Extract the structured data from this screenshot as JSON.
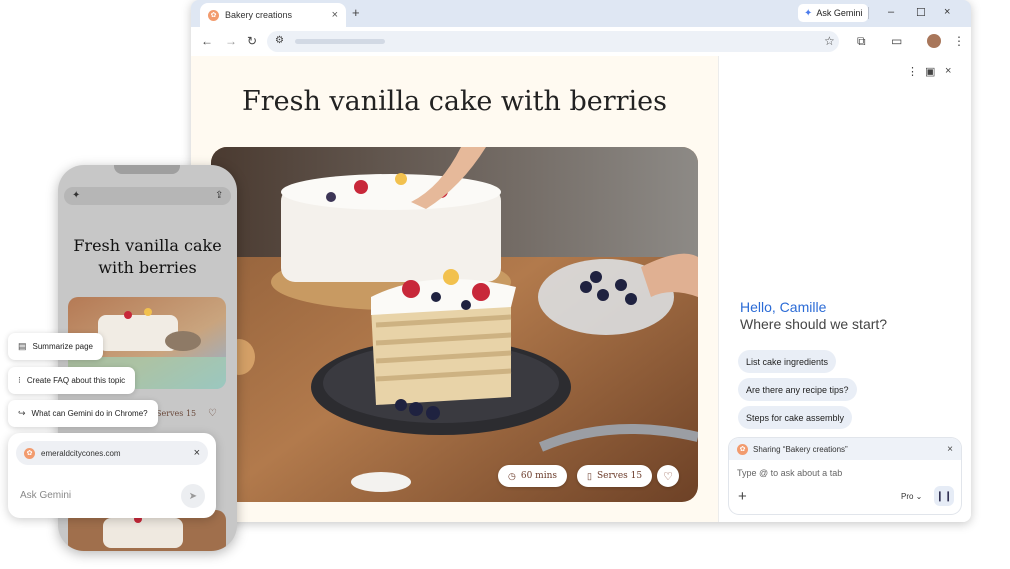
{
  "browser": {
    "tab_title": "Bakery creations",
    "new_tab_glyph": "+",
    "tab_close_glyph": "×",
    "ask_gemini_label": "Ask Gemini",
    "window_controls": {
      "minimize": "–",
      "maximize": "☐",
      "close": "×"
    },
    "toolbar": {
      "back": "←",
      "forward": "→",
      "reload": "↻",
      "tune": "⚙",
      "star": "☆",
      "extensions": "⧉",
      "cast": "▭",
      "menu": "⋮"
    }
  },
  "page": {
    "title": "Fresh vanilla cake with berries",
    "time_icon": "◷",
    "time_label": "60 mins",
    "serves_icon": "▯",
    "serves_label": "Serves 15",
    "heart_glyph": "♡"
  },
  "side_panel": {
    "menu_glyph": "⋮",
    "dock_glyph": "▣",
    "close_glyph": "×",
    "greeting_name": "Hello, Camille",
    "greeting_prompt": "Where should we start?",
    "chips": [
      "List cake ingredients",
      "Are there any recipe tips?",
      "Steps for cake assembly"
    ],
    "sharing_label": "Sharing “Bakery creations”",
    "input_placeholder": "Type @ to ask about a tab",
    "plus_glyph": "+",
    "mode_label": "Pro ⌄",
    "mic_glyph": "❙❙"
  },
  "phone": {
    "title": "Fresh vanilla cake with berries",
    "serves_label": "Serves 15",
    "heart_glyph": "♡",
    "spark_glyph": "✦",
    "share_glyph": "⇪"
  },
  "assist": {
    "chips": [
      "Summarize page",
      "Create FAQ about this topic",
      "What can Gemini do in Chrome?"
    ],
    "chip_icons": [
      "▤",
      "⁝",
      "↪"
    ],
    "url_chip": "emeraldcitycones.com",
    "url_close": "×",
    "ask_placeholder": "Ask Gemini",
    "send_glyph": "➤"
  },
  "colors": {
    "accent_blue": "#2b6bd6",
    "chip_bg": "#e9eef6",
    "page_bg": "#fffaf1",
    "pill_text": "#6b3b2a"
  }
}
